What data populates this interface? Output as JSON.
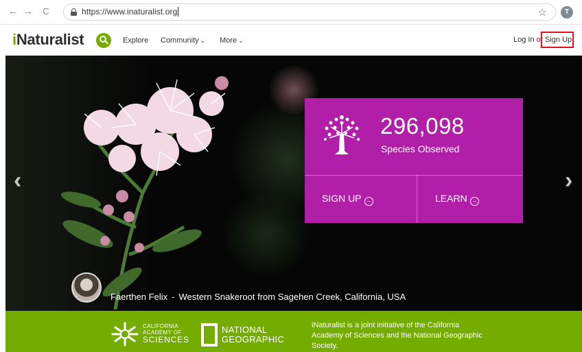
{
  "browser": {
    "back_icon": "←",
    "forward_icon": "→",
    "reload_icon": "C",
    "url": "https://www.inaturalist.org",
    "star_icon": "☆",
    "profile_initial": "T"
  },
  "header": {
    "logo_prefix": "i",
    "logo_rest": "Naturalist",
    "nav": [
      {
        "label": "Explore",
        "has_dropdown": false
      },
      {
        "label": "Community",
        "has_dropdown": true
      },
      {
        "label": "More",
        "has_dropdown": true
      }
    ],
    "login_label": "Log In or",
    "signup_label": "Sign Up",
    "highlight_color": "#e0121c"
  },
  "hero": {
    "prev_icon": "‹",
    "next_icon": "›",
    "stat_count": "296,098",
    "stat_label": "Species Observed",
    "signup_cta": "SIGN UP",
    "learn_cta": "LEARN",
    "cta_icon": "→",
    "card_color": "#b11fa8",
    "caption_user": "Faerthen Felix",
    "caption_separator": "-",
    "caption_species": "Western Snakeroot",
    "caption_from": "from Sagehen Creek, California, USA"
  },
  "footer": {
    "color": "#74ac00",
    "cas_line1": "CALIFORNIA",
    "cas_line2": "ACADEMY OF",
    "cas_line3": "SCIENCES",
    "ng_line1": "NATIONAL",
    "ng_line2": "GEOGRAPHIC",
    "blurb": "iNaturalist is a joint initiative of the California Academy of Sciences and the National Geographic Society."
  }
}
